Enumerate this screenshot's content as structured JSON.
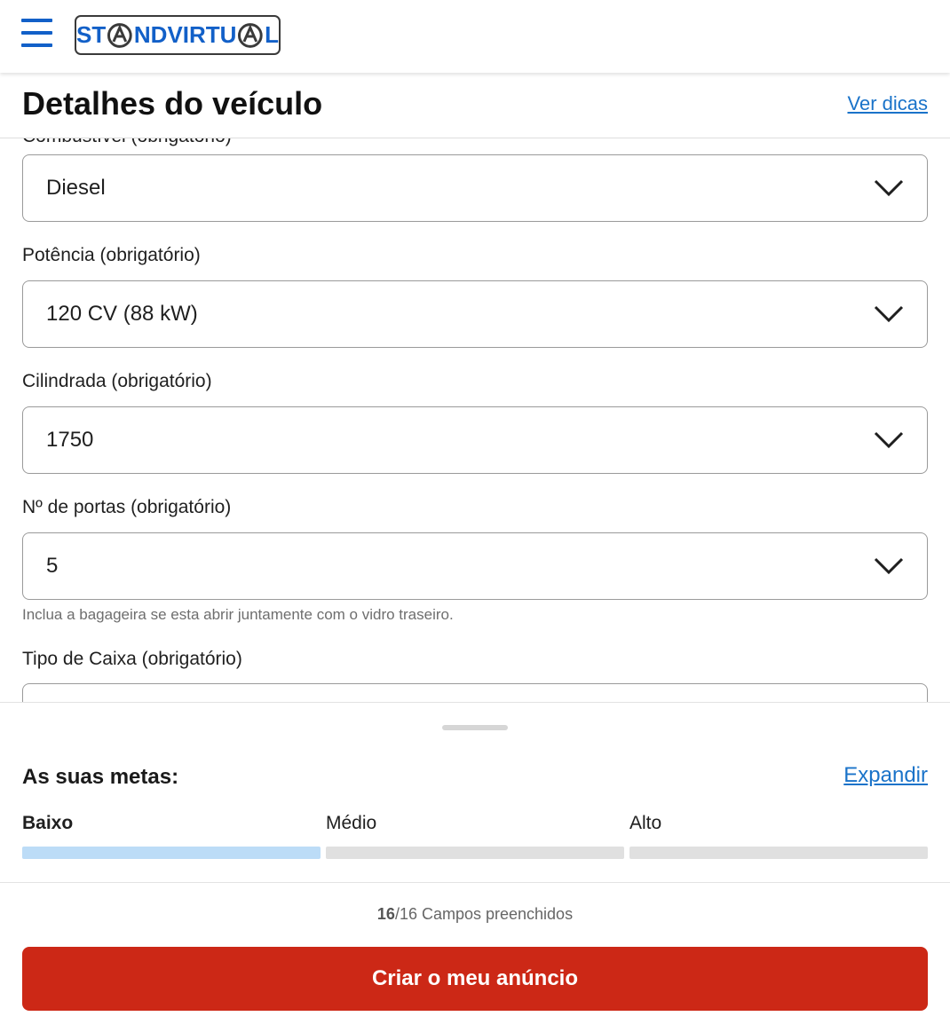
{
  "header": {
    "logo_text_left": "ST",
    "logo_text_mid": "NDVIRTU",
    "logo_text_right": "L",
    "brand_color": "#1260c8"
  },
  "page": {
    "title": "Detalhes do veículo",
    "tips_link": "Ver dicas"
  },
  "form": {
    "fields": [
      {
        "label": "Combustível (obrigatório)",
        "value": "Diesel"
      },
      {
        "label": "Potência (obrigatório)",
        "value": "120 CV (88 kW)"
      },
      {
        "label": "Cilindrada (obrigatório)",
        "value": "1750"
      },
      {
        "label": "Nº de portas (obrigatório)",
        "value": "5",
        "hint": "Inclua a bagageira se esta abrir juntamente com o vidro traseiro."
      },
      {
        "label": "Tipo de Caixa (obrigatório)",
        "value": ""
      }
    ]
  },
  "goals": {
    "title": "As suas metas:",
    "expand_link": "Expandir",
    "levels": [
      "Baixo",
      "Médio",
      "Alto"
    ],
    "current_level": "Baixo",
    "active_color": "#bcdcf7"
  },
  "progress": {
    "filled": "16",
    "total_text": "/16 Campos preenchidos"
  },
  "cta": {
    "label": "Criar o meu anúncio",
    "color": "#cc2816"
  }
}
